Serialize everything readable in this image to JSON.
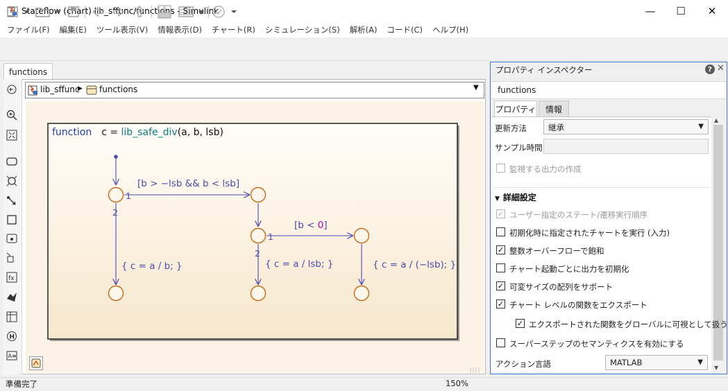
{
  "window": {
    "title": "Stateflow (chart) lib_sffunc/functions - Simulink",
    "min_glyph": "—",
    "max_glyph": "☐",
    "close_glyph": "✕"
  },
  "menu": [
    "ファイル(F)",
    "編集(E)",
    "ツール表示(V)",
    "情報表示(D)",
    "チャート(R)",
    "シミュレーション(S)",
    "解析(A)",
    "コード(C)",
    "ヘルプ(H)"
  ],
  "doc_tab": "functions",
  "breadcrumb": {
    "root": "lib_sffunc",
    "separator": "▶",
    "current": "functions",
    "dropdown": "▼"
  },
  "chart": {
    "func_keyword": "function",
    "signature_lhs": "c = ",
    "func_name": "lib_safe_div",
    "signature_args": "(a, b, lsb)",
    "cond1": "[b > −lsb && b < lsb]",
    "cond2_open": "[b < ",
    "cond2_value": "0",
    "cond2_close": "]",
    "action1": "{ c = a / b; }",
    "action2": "{ c = a / lsb; }",
    "action3": "{ c = a / (−lsb); }",
    "order_1a": "1",
    "order_2a": "2",
    "order_1b": "1",
    "order_2b": "2",
    "colors": {
      "keyword": "#1f3fa8",
      "func_name": "#0a7f7f",
      "transition": "#4b4bb0",
      "junction": "#c56a12",
      "number": "#b000b0"
    }
  },
  "inspector": {
    "title": "プロパティ インスペクター",
    "help": "?",
    "close": "✕",
    "object_name": "functions",
    "tabs": {
      "properties": "プロパティ",
      "info": "情報"
    },
    "update_method_label": "更新方法",
    "update_method_value": "継承",
    "sample_time_label": "サンプル時間",
    "sample_time_value": "",
    "monitor_label": "監視する出力の作成",
    "advanced_header": "詳細設定",
    "options": [
      {
        "label": "ユーザー指定のステート/遷移実行順序",
        "checked": "✓",
        "disabled": true
      },
      {
        "label": "初期化時に指定されたチャートを実行 (入力)",
        "checked": ""
      },
      {
        "label": "整数オーバーフローで飽和",
        "checked": "✓"
      },
      {
        "label": "チャート起動ごとに出力を初期化",
        "checked": ""
      },
      {
        "label": "可変サイズの配列をサポート",
        "checked": "✓"
      },
      {
        "label": "チャート レベルの関数をエクスポート",
        "checked": "✓"
      },
      {
        "label": "エクスポートされた関数をグローバルに可視として扱う",
        "checked": "✓"
      },
      {
        "label": "スーパーステップのセマンティクスを有効にする",
        "checked": ""
      }
    ],
    "action_lang_label": "アクション言語",
    "action_lang_value": "MATLAB"
  },
  "status": {
    "text": "準備完了",
    "zoom": "150%"
  }
}
